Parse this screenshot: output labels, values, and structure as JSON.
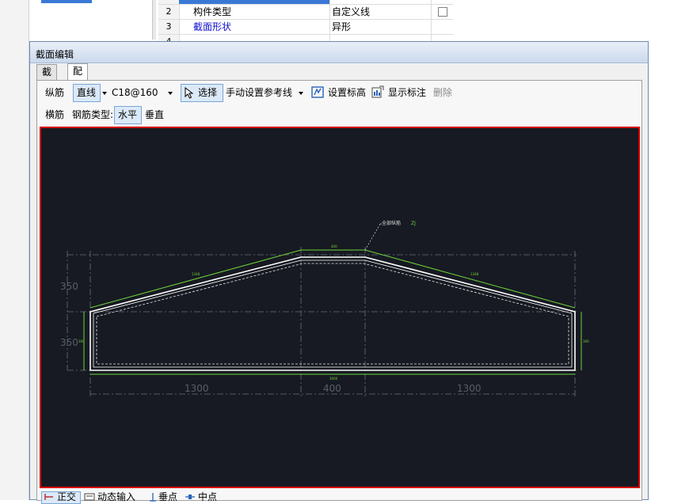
{
  "property_grid": {
    "rows": [
      {
        "num": "",
        "name": "",
        "value": ""
      },
      {
        "num": "2",
        "name": "构件类型",
        "value": "自定义线"
      },
      {
        "num": "3",
        "name": "截面形状",
        "value": "异形"
      },
      {
        "num": "4",
        "name": "",
        "value": ""
      }
    ]
  },
  "dialog": {
    "title": "截面编辑",
    "tabs": [
      {
        "label": "截面",
        "active": false
      },
      {
        "label": "配筋",
        "active": true
      }
    ],
    "toolbar1": {
      "label_longitudinal": "纵筋",
      "line_mode": "直线",
      "rebar_spec": "C18@160",
      "select": "选择",
      "manual_ref_line": "手动设置参考线",
      "set_elevation": "设置标高",
      "show_annotation": "显示标注",
      "delete": "删除"
    },
    "toolbar2": {
      "label_transverse": "横筋",
      "rebar_type_label": "钢筋类型:",
      "horizontal": "水平",
      "vertical": "垂直"
    },
    "drawing": {
      "leader_label": "全部纵筋",
      "leader_tag": "ZJ",
      "dims_bottom": [
        "1300",
        "400",
        "1300"
      ],
      "dims_left": [
        "350",
        "350"
      ]
    },
    "status_bar": {
      "ortho": "正交",
      "dynamic_input": "动态输入",
      "perpendicular": "垂点",
      "midpoint": "中点"
    }
  },
  "colors": {
    "canvas_bg": "#171a22",
    "canvas_border": "#d40000",
    "rebar_green": "#6fd23a",
    "outline_white": "#ffffff",
    "blue_link_text": "#1010d0"
  }
}
